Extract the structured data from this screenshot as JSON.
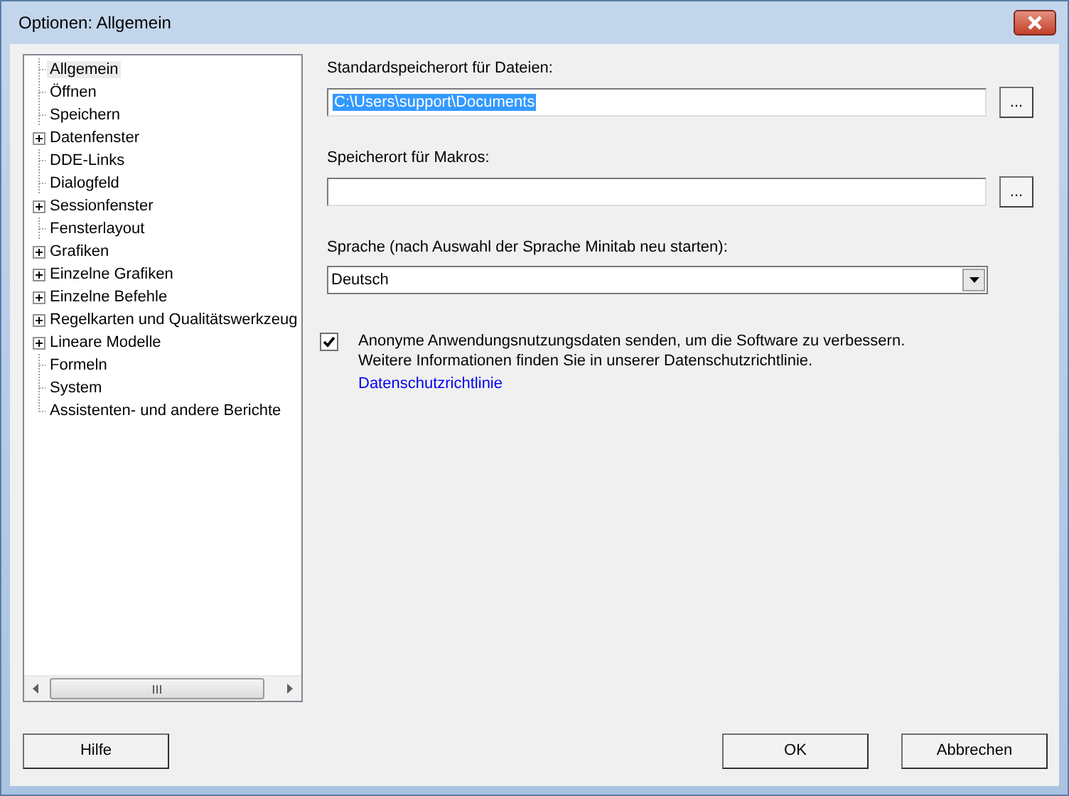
{
  "window": {
    "title": "Optionen: Allgemein"
  },
  "tree": {
    "items": [
      {
        "label": "Allgemein",
        "expandable": false,
        "selected": true
      },
      {
        "label": "Öffnen",
        "expandable": false,
        "selected": false
      },
      {
        "label": "Speichern",
        "expandable": false,
        "selected": false
      },
      {
        "label": "Datenfenster",
        "expandable": true,
        "selected": false
      },
      {
        "label": "DDE-Links",
        "expandable": false,
        "selected": false
      },
      {
        "label": "Dialogfeld",
        "expandable": false,
        "selected": false
      },
      {
        "label": "Sessionfenster",
        "expandable": true,
        "selected": false
      },
      {
        "label": "Fensterlayout",
        "expandable": false,
        "selected": false
      },
      {
        "label": "Grafiken",
        "expandable": true,
        "selected": false
      },
      {
        "label": "Einzelne Grafiken",
        "expandable": true,
        "selected": false
      },
      {
        "label": "Einzelne Befehle",
        "expandable": true,
        "selected": false
      },
      {
        "label": "Regelkarten und Qualitätswerkzeug",
        "expandable": true,
        "selected": false
      },
      {
        "label": "Lineare Modelle",
        "expandable": true,
        "selected": false
      },
      {
        "label": "Formeln",
        "expandable": false,
        "selected": false
      },
      {
        "label": "System",
        "expandable": false,
        "selected": false
      },
      {
        "label": "Assistenten- und andere Berichte",
        "expandable": false,
        "selected": false
      }
    ]
  },
  "default_location": {
    "label": "Standardspeicherort für Dateien:",
    "value": "C:\\Users\\support\\Documents",
    "browse": "..."
  },
  "macro_location": {
    "label": "Speicherort für Makros:",
    "browse": "..."
  },
  "language": {
    "label": "Sprache (nach Auswahl der Sprache Minitab neu starten):",
    "value": "Deutsch"
  },
  "usage_data": {
    "checked": true,
    "text": "Anonyme Anwendungsnutzungsdaten senden, um die Software zu verbessern.",
    "info": "Weitere Informationen finden Sie in unserer Datenschutzrichtlinie.",
    "link": "Datenschutzrichtlinie"
  },
  "buttons": {
    "help": "Hilfe",
    "ok": "OK",
    "cancel": "Abbrechen"
  }
}
